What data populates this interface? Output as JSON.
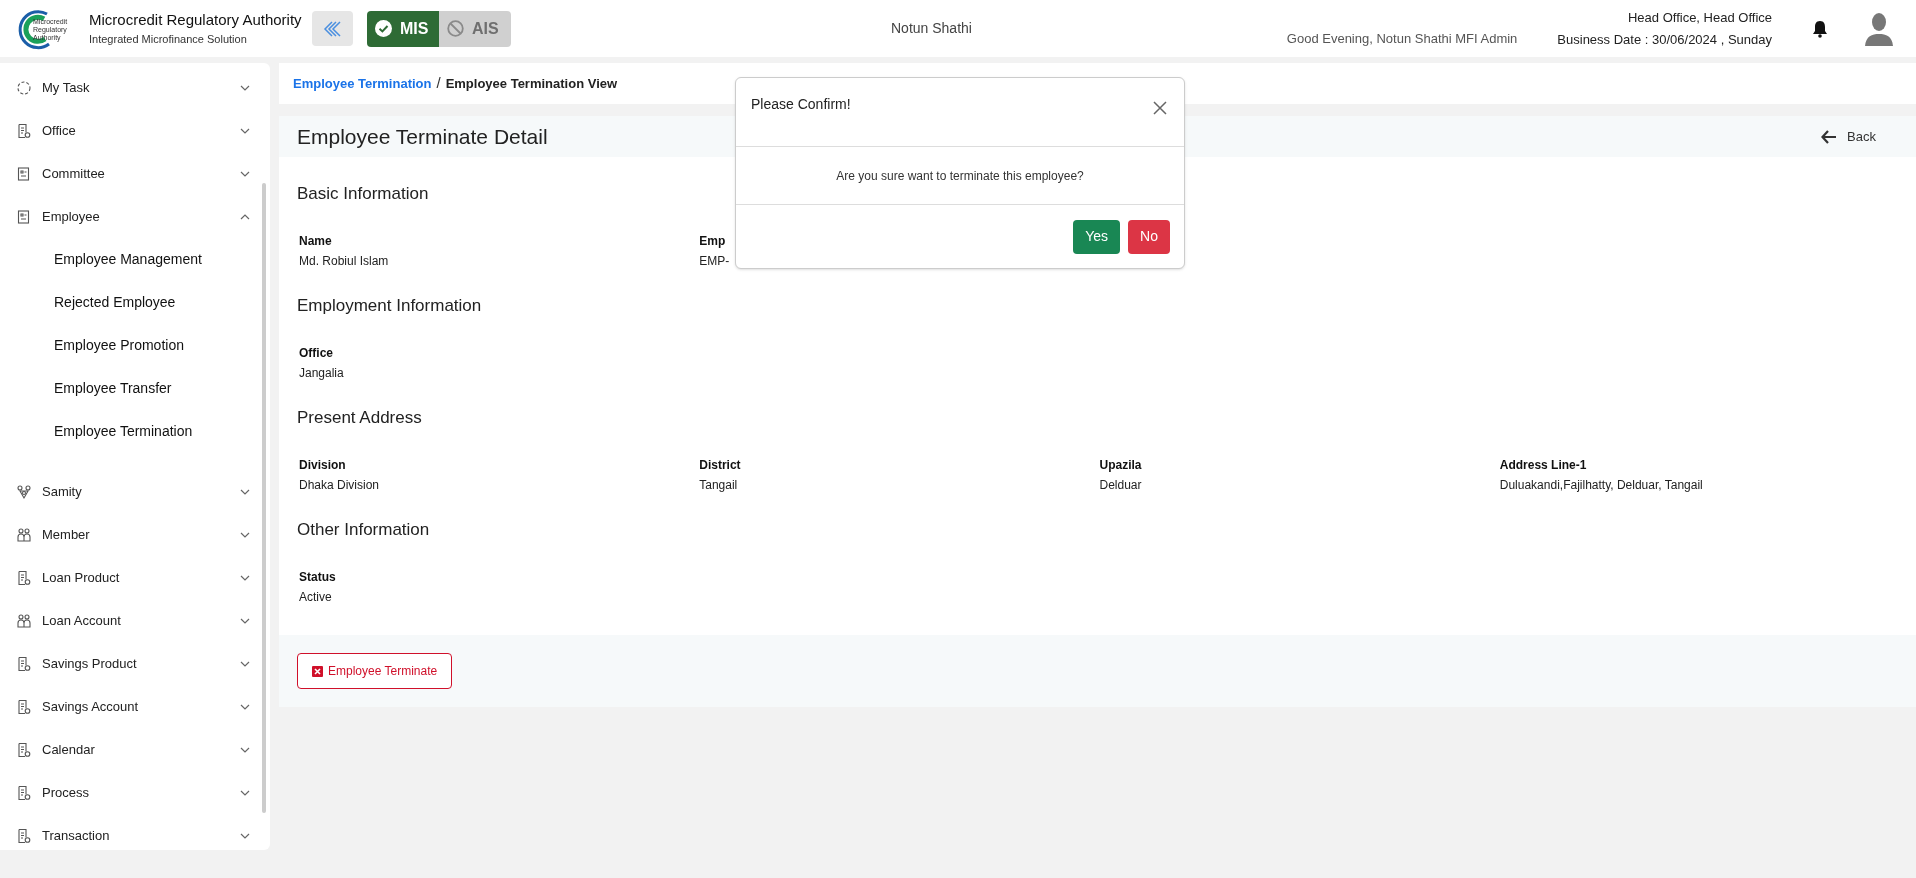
{
  "header": {
    "org_title": "Microcredit Regulatory Authority",
    "org_subtitle": "Integrated Microfinance Solution",
    "logo_text": [
      "Microcredit",
      "Regulatory",
      "Authority"
    ],
    "modules": [
      {
        "label": "MIS",
        "selected": true
      },
      {
        "label": "AIS",
        "selected": false
      }
    ],
    "center_title": "Notun Shathi",
    "greeting": "Good Evening, Notun Shathi MFI Admin",
    "office": "Head Office, Head Office",
    "business_date": "Business Date : 30/06/2024 , Sunday"
  },
  "sidebar": {
    "items": [
      {
        "label": "My Task",
        "kind": "task",
        "expanded": false
      },
      {
        "label": "Office",
        "kind": "document",
        "expanded": false
      },
      {
        "label": "Committee",
        "kind": "board",
        "expanded": false
      },
      {
        "label": "Employee",
        "kind": "board",
        "expanded": true,
        "children": [
          {
            "label": "Employee Management"
          },
          {
            "label": "Rejected Employee"
          },
          {
            "label": "Employee Promotion"
          },
          {
            "label": "Employee Transfer"
          },
          {
            "label": "Employee Termination"
          }
        ]
      },
      {
        "label": "Samity",
        "kind": "group",
        "expanded": false
      },
      {
        "label": "Member",
        "kind": "people",
        "expanded": false
      },
      {
        "label": "Loan Product",
        "kind": "document",
        "expanded": false
      },
      {
        "label": "Loan Account",
        "kind": "people",
        "expanded": false
      },
      {
        "label": "Savings Product",
        "kind": "document",
        "expanded": false
      },
      {
        "label": "Savings Account",
        "kind": "document",
        "expanded": false
      },
      {
        "label": "Calendar",
        "kind": "document",
        "expanded": false
      },
      {
        "label": "Process",
        "kind": "document",
        "expanded": false
      },
      {
        "label": "Transaction",
        "kind": "document",
        "expanded": false
      }
    ]
  },
  "breadcrumb": [
    {
      "label": "Employee Termination",
      "kind": "link"
    },
    {
      "label": "/",
      "kind": "separator"
    },
    {
      "label": "Employee Termination View",
      "kind": "current"
    }
  ],
  "page_title": "Employee Terminate Detail",
  "back_label": "Back",
  "sections": [
    {
      "title": "Basic Information",
      "fields": [
        {
          "label": "Name",
          "value": "Md. Robiul Islam"
        },
        {
          "label": "Emp",
          "value": "EMP-"
        }
      ]
    },
    {
      "title": "Employment Information",
      "fields": [
        {
          "label": "Office",
          "value": "Jangalia"
        }
      ]
    },
    {
      "title": "Present Address",
      "fields": [
        {
          "label": "Division",
          "value": "Dhaka Division"
        },
        {
          "label": "District",
          "value": "Tangail"
        },
        {
          "label": "Upazila",
          "value": "Delduar"
        },
        {
          "label": "Address Line-1",
          "value": "Duluakandi,Fajilhatty, Delduar, Tangail"
        }
      ]
    },
    {
      "title": "Other Information",
      "fields": [
        {
          "label": "Status",
          "value": "Active"
        }
      ]
    }
  ],
  "terminate_button": "Employee Terminate",
  "modal": {
    "title": "Please Confirm!",
    "message": "Are you sure want to terminate this employee?",
    "buttons": [
      {
        "label": "Yes",
        "kind": "confirm"
      },
      {
        "label": "No",
        "kind": "cancel"
      }
    ]
  }
}
